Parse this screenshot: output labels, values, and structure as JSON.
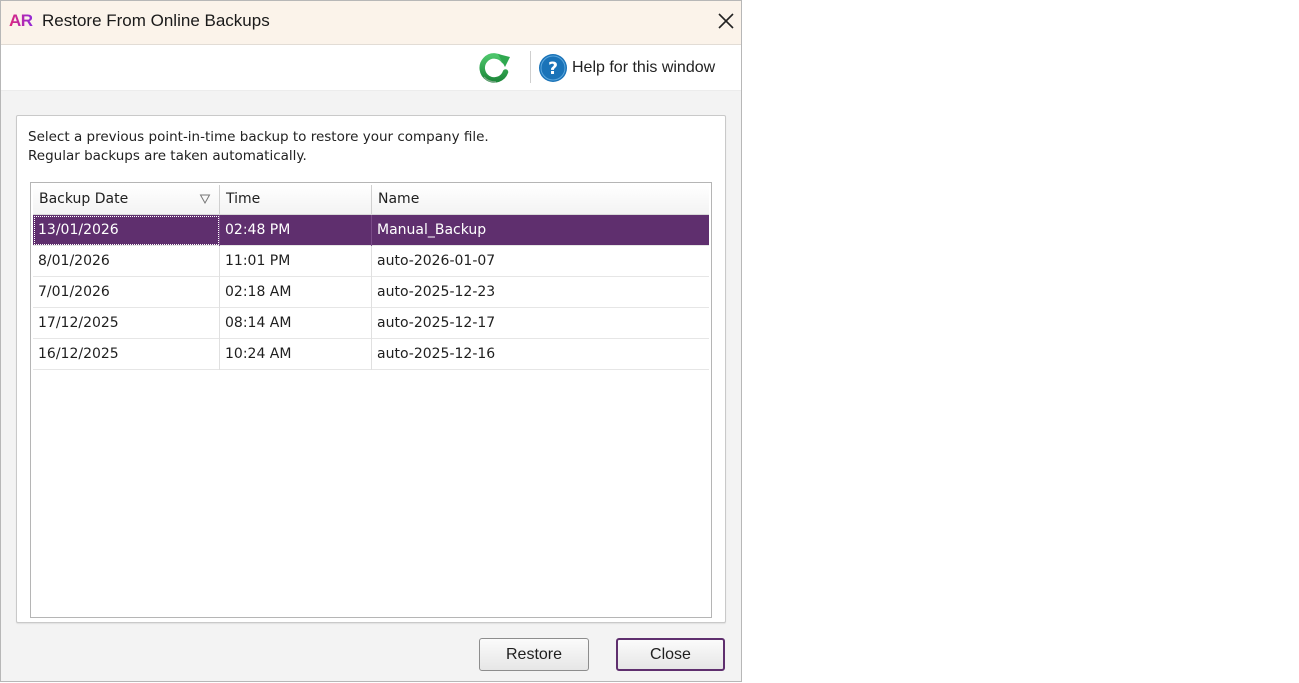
{
  "window": {
    "logo_text": "AR",
    "title": "Restore From Online Backups",
    "close_icon": "close-icon"
  },
  "toolbar": {
    "refresh_icon": "refresh-icon",
    "help_label": "Help for this window",
    "help_icon": "help-icon"
  },
  "instructions": {
    "line1": "Select a previous point-in-time backup to restore your company file.",
    "line2": "Regular backups are taken automatically."
  },
  "table": {
    "columns": [
      "Backup Date",
      "Time",
      "Name"
    ],
    "sort_icon": "sort-descending-icon",
    "selected_row": 0,
    "rows": [
      {
        "date": "13/01/2026",
        "time": "02:48 PM",
        "name": "Manual_Backup"
      },
      {
        "date": "8/01/2026",
        "time": "11:01 PM",
        "name": "auto-2026-01-07"
      },
      {
        "date": "7/01/2026",
        "time": "02:18 AM",
        "name": "auto-2025-12-23"
      },
      {
        "date": "17/12/2025",
        "time": "08:14 AM",
        "name": "auto-2025-12-17"
      },
      {
        "date": "16/12/2025",
        "time": "10:24 AM",
        "name": "auto-2025-12-16"
      }
    ]
  },
  "buttons": {
    "restore_label": "Restore",
    "close_label": "Close"
  },
  "colors": {
    "selection": "#5f2f6e",
    "titlebar": "#fbf3ea",
    "refresh_green": "#2fa84f",
    "help_blue": "#1a73b8"
  }
}
